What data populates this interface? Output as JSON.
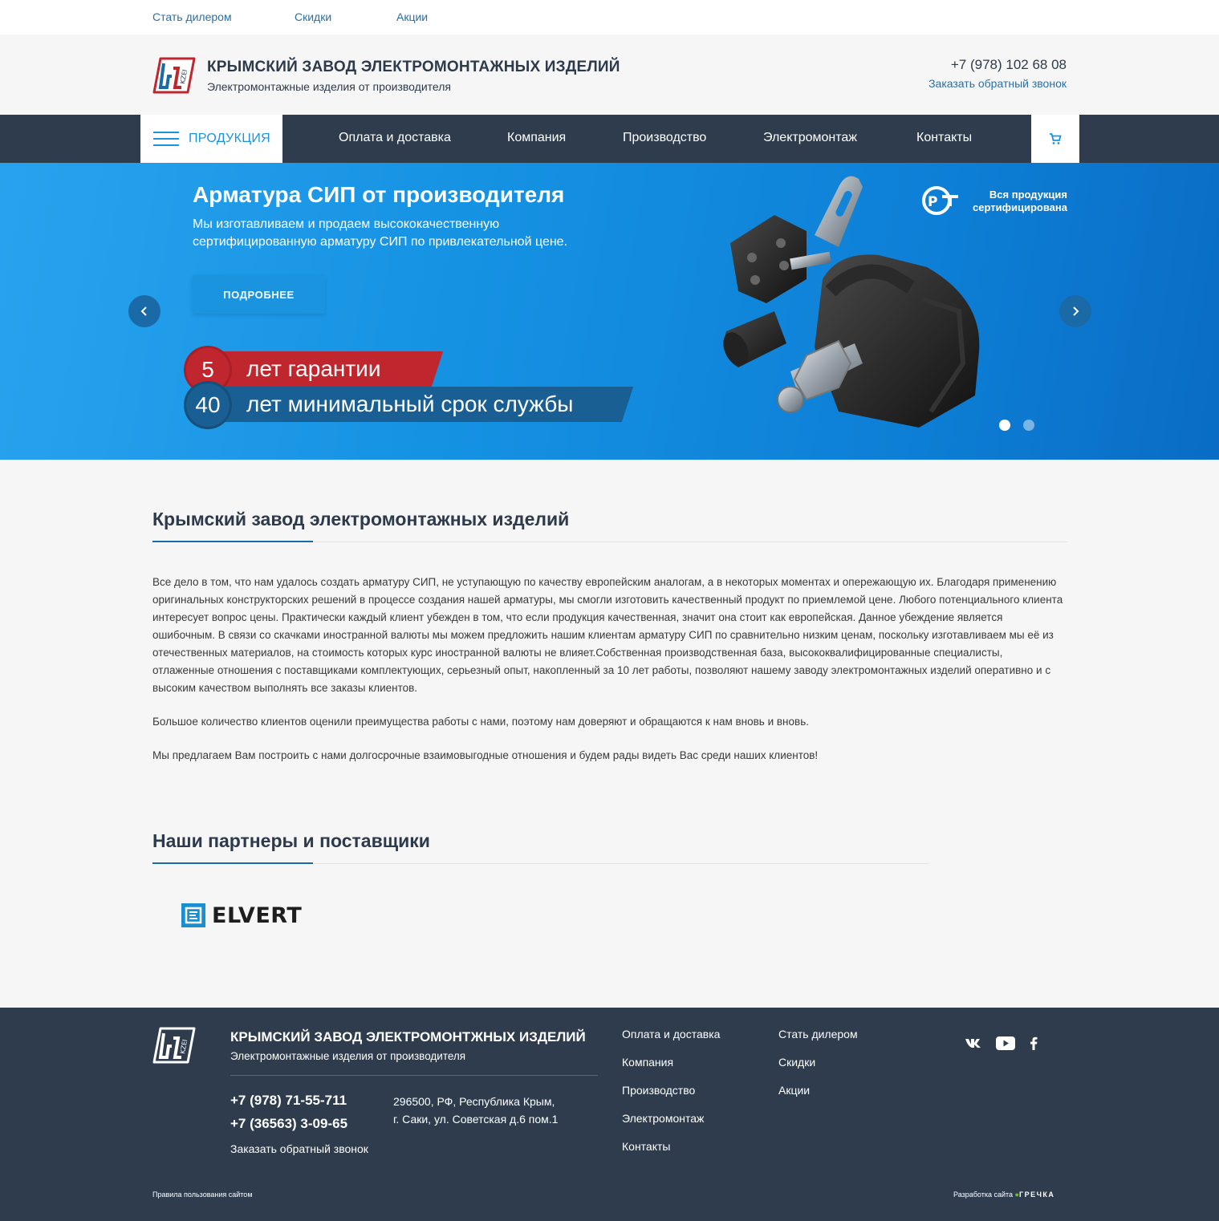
{
  "topbar": {
    "links": [
      "Стать дилером",
      "Скидки",
      "Акции"
    ]
  },
  "header": {
    "title": "КРЫМСКИЙ ЗАВОД ЭЛЕКТРОМОНТАЖНЫХ ИЗДЕЛИЙ",
    "subtitle": "Электромонтажные изделия от производителя",
    "phone": "+7 (978) 102 68 08",
    "callback": "Заказать обратный звонок"
  },
  "nav": {
    "products": "ПРОДУКЦИЯ",
    "items": [
      "Оплата и доставка",
      "Компания",
      "Производство",
      "Электромонтаж",
      "Контакты"
    ]
  },
  "hero": {
    "title": "Арматура СИП от производителя",
    "text": "Мы изготавливаем и продаем высококачественную сертифицированную арматуру СИП по привлекательной цене.",
    "button": "ПОДРОБНЕЕ",
    "cert_line1": "Вся продукция",
    "cert_line2": "сертифицирована",
    "badges": [
      {
        "num": "5",
        "label": "лет гарантии"
      },
      {
        "num": "40",
        "label": "лет минимальный срок службы"
      }
    ]
  },
  "about": {
    "title": "Крымский завод электромонтажных изделий",
    "paragraphs": [
      "Все дело в том, что нам удалось создать арматуру СИП, не уступающую по качеству европейским аналогам, а в некоторых моментах и опережающую их. Благодаря применению оригинальных конструкторских решений в процессе создания нашей арматуры, мы смогли изготовить качественный продукт по приемлемой цене. Любого потенциального клиента интересует вопрос цены. Практически каждый клиент убежден в том, что если продукция качественная, значит она стоит как европейская. Данное убеждение является ошибочным. В связи со скачками иностранной валюты мы можем предложить нашим клиентам арматуру СИП по сравнительно низким ценам, поскольку изготавливаем мы её из отечественных материалов, на стоимость которых курс иностранной валюты не влияет.Собственная производственная база, высококвалифицированные специалисты, отлаженные отношения с поставщиками комплектующих, серьезный опыт, накопленный за 10 лет работы, позволяют нашему заводу электромонтажных изделий оперативно и с высоким качеством выполнять все заказы клиентов.",
      "Большое количество клиентов оценили преимущества работы с нами, поэтому нам доверяют и обращаются к нам вновь и вновь.",
      "Мы предлагаем Вам построить с нами долгосрочные взаимовыгодные отношения и будем рады видеть Вас среди наших клиентов!"
    ]
  },
  "partners": {
    "title": "Наши партнеры и поставщики",
    "logo_text": "ELVERT"
  },
  "footer": {
    "title": "КРЫМСКИЙ ЗАВОД ЭЛЕКТРОМОНТЖНЫХ ИЗДЕЛИЙ",
    "subtitle": "Электромонтажные изделия от производителя",
    "phones": [
      "+7 (978) 71-55-711",
      "+7 (36563) 3-09-65"
    ],
    "callback": "Заказать обратный звонок",
    "address_line1": "296500, РФ, Республика Крым,",
    "address_line2": "г. Саки, ул. Советская д.6 пом.1",
    "links_col1": [
      "Оплата и доставка",
      "Компания",
      "Производство",
      "Электромонтаж",
      "Контакты"
    ],
    "links_col2": [
      "Стать дилером",
      "Скидки",
      "Акции"
    ],
    "social": [
      "vk-icon",
      "youtube-icon",
      "facebook-icon"
    ],
    "terms": "Правила пользования сайтом",
    "dev_label": "Разработка сайта",
    "dev_name": "ГРЕЧКА"
  },
  "colors": {
    "accent": "#1b94e0",
    "nav_bg": "#2e3c4e",
    "badge_red": "#c0262d",
    "badge_dark": "#1a5f93"
  }
}
